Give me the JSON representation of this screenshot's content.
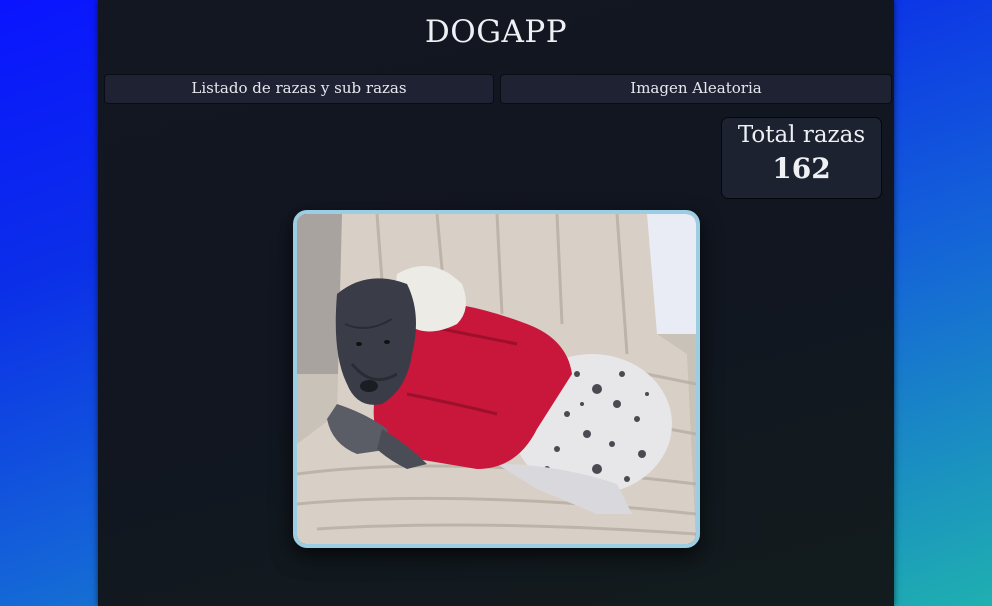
{
  "app": {
    "title": "DOGAPP"
  },
  "nav": {
    "breeds_button": "Listado de razas y sub razas",
    "random_button": "Imagen Aleatoria"
  },
  "stats": {
    "label": "Total razas",
    "value": "162"
  },
  "image": {
    "subject": "dog-photo"
  },
  "colors": {
    "page_gradient_start": "#0a14ff",
    "page_gradient_end": "#1fb0b0",
    "panel": "#131722",
    "button_bg": "#1e2233",
    "frame_border": "#9dcde3"
  }
}
